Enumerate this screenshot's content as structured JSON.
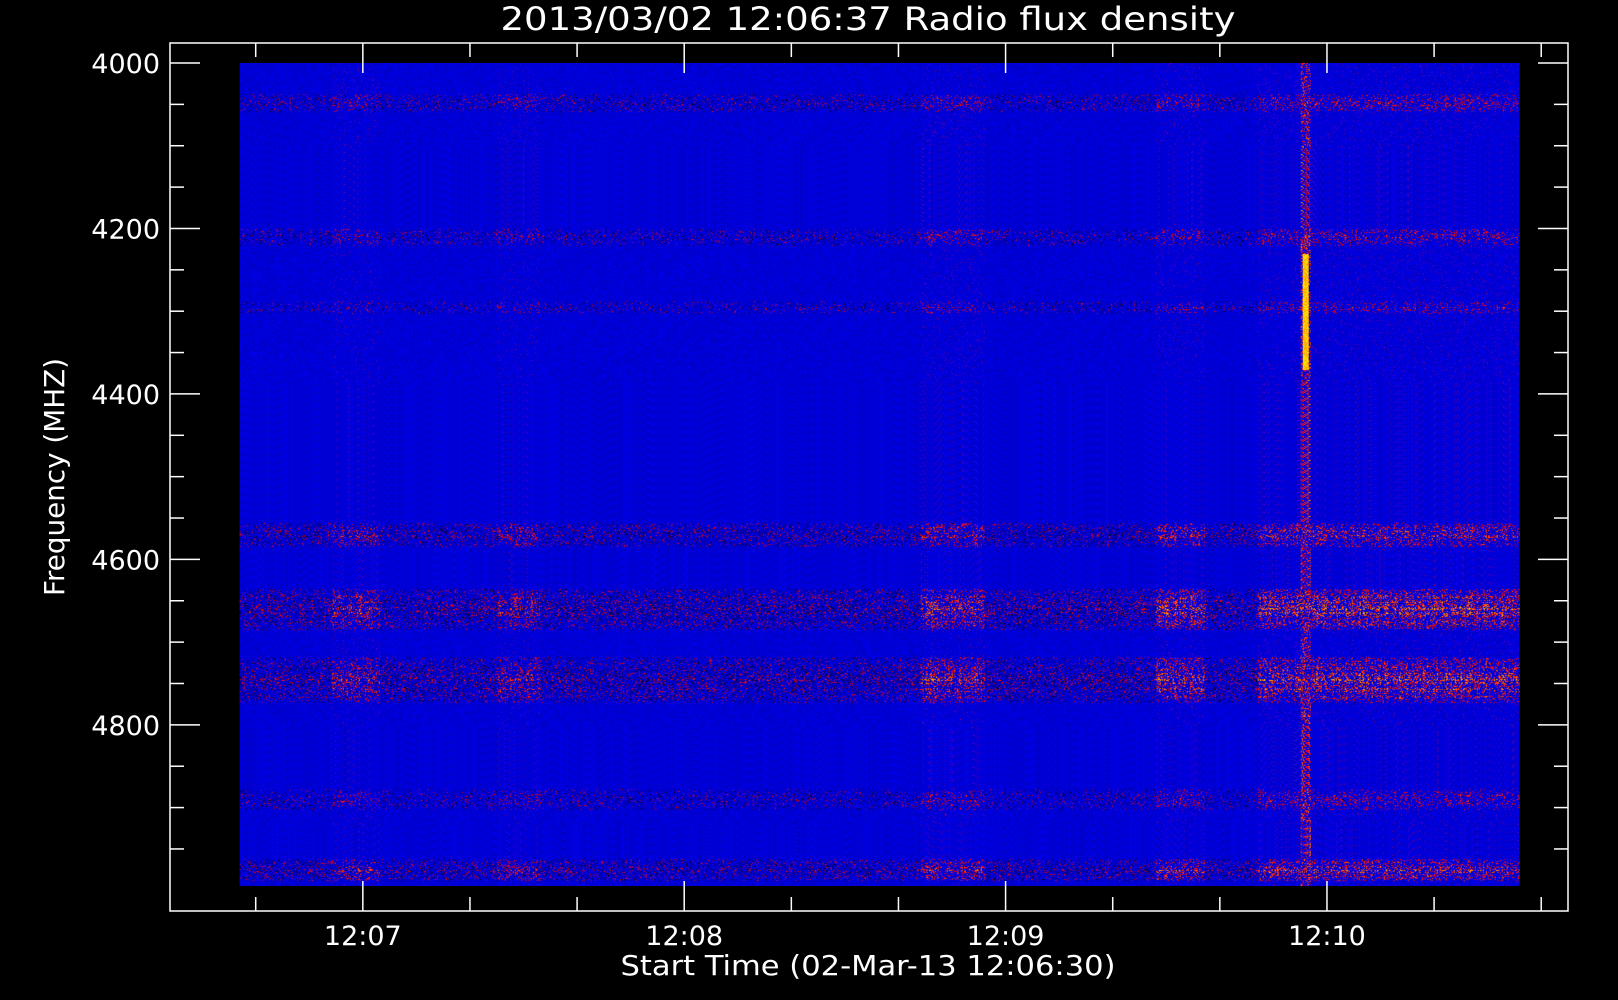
{
  "chart_data": {
    "type": "heatmap",
    "title": "2013/03/02 12:06:37 Radio flux density",
    "xlabel": "Start Time (02-Mar-13 12:06:30)",
    "ylabel": "Frequency (MHZ)",
    "x_major_ticks": [
      "12:07",
      "12:08",
      "12:09",
      "12:10"
    ],
    "y_major_ticks": [
      "4000",
      "4200",
      "4400",
      "4600",
      "4800"
    ],
    "xlim": [
      "12:06:24",
      "12:10:45"
    ],
    "ylim": [
      4000,
      5025
    ],
    "data_extent": {
      "t_start": "12:06:37",
      "t_end": "12:10:36",
      "f_start": 4000,
      "f_end": 4995
    },
    "y_axis_inverted": true,
    "colormap": [
      "#000000",
      "#0000ff",
      "#ff0000",
      "#ffff00"
    ],
    "background_color": "#0000ff",
    "frequency_bands": [
      {
        "center": 4048,
        "width": 22,
        "level": 0.38
      },
      {
        "center": 4210,
        "width": 20,
        "level": 0.35
      },
      {
        "center": 4295,
        "width": 16,
        "level": 0.28
      },
      {
        "center": 4570,
        "width": 30,
        "level": 0.5
      },
      {
        "center": 4660,
        "width": 50,
        "level": 0.6
      },
      {
        "center": 4745,
        "width": 55,
        "level": 0.6
      },
      {
        "center": 4890,
        "width": 25,
        "level": 0.35
      },
      {
        "center": 4975,
        "width": 26,
        "level": 0.55
      }
    ],
    "bright_time_bands": [
      {
        "start": "12:06:54",
        "end": "12:07:03",
        "level": 0.55
      },
      {
        "start": "12:07:25",
        "end": "12:07:33",
        "level": 0.5
      },
      {
        "start": "12:08:44",
        "end": "12:08:56",
        "level": 0.75
      },
      {
        "start": "12:09:28",
        "end": "12:09:37",
        "level": 0.8
      },
      {
        "start": "12:09:47",
        "end": "12:10:36",
        "level": 0.85
      }
    ],
    "burst": {
      "time": "12:09:56",
      "f_start": 4000,
      "f_end": 4995,
      "peak_f_start": 4230,
      "peak_f_end": 4370
    }
  }
}
